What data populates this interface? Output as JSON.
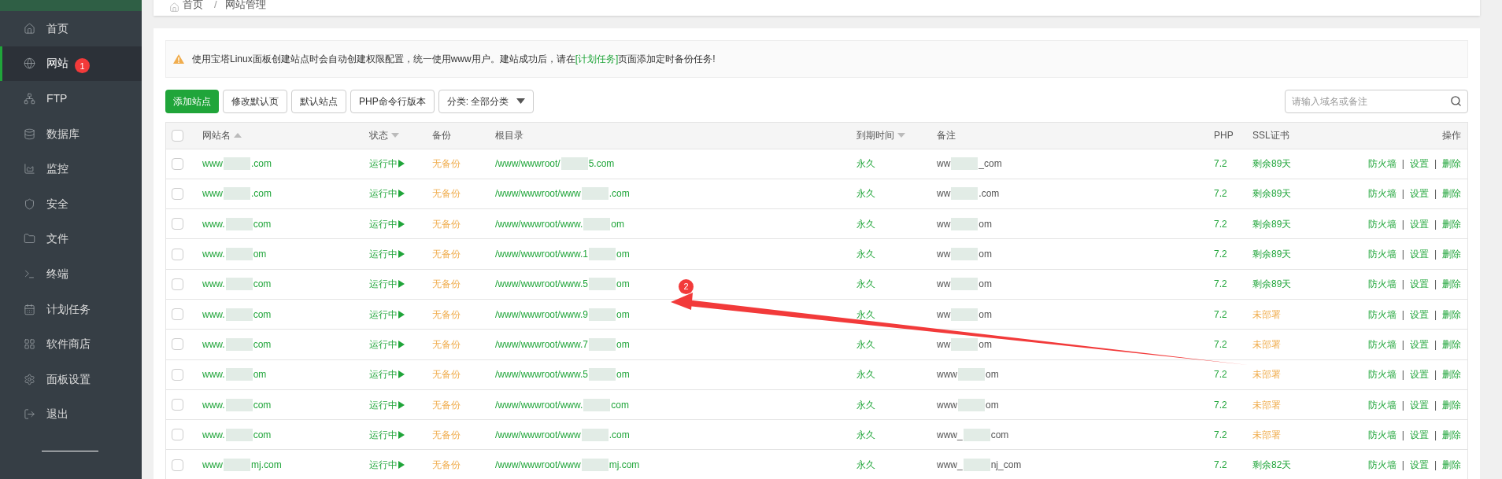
{
  "sidebar": {
    "items": [
      {
        "label": "首页",
        "selected": false
      },
      {
        "label": "网站",
        "selected": true,
        "badge": "1"
      },
      {
        "label": "FTP",
        "selected": false
      },
      {
        "label": "数据库",
        "selected": false
      },
      {
        "label": "监控",
        "selected": false
      },
      {
        "label": "安全",
        "selected": false
      },
      {
        "label": "文件",
        "selected": false
      },
      {
        "label": "终端",
        "selected": false
      },
      {
        "label": "计划任务",
        "selected": false
      },
      {
        "label": "软件商店",
        "selected": false
      },
      {
        "label": "面板设置",
        "selected": false
      },
      {
        "label": "退出",
        "selected": false
      }
    ]
  },
  "breadcrumb": {
    "items": [
      "首页",
      "网站管理"
    ],
    "separator": "/"
  },
  "alert": {
    "before": "使用宝塔Linux面板创建站点时会自动创建权限配置，统一使用www用户。建站成功后，请在",
    "link": "[计划任务]",
    "after": "页面添加定时备份任务!"
  },
  "toolbar": {
    "buttons": [
      {
        "label": "添加站点",
        "kind": "primary"
      },
      {
        "label": "修改默认页",
        "kind": "default"
      },
      {
        "label": "默认站点",
        "kind": "default"
      },
      {
        "label": "PHP命令行版本",
        "kind": "default"
      },
      {
        "label": "分类: 全部分类",
        "kind": "dropdown"
      }
    ],
    "search": {
      "placeholder": "请输入域名或备注"
    }
  },
  "table": {
    "header_checked": false,
    "action_separator": "|",
    "columns": [
      {
        "label": "网站名",
        "kind": "ascending"
      },
      {
        "label": "状态",
        "kind": "descending"
      },
      {
        "label": "备份",
        "kind": "plain"
      },
      {
        "label": "根目录",
        "kind": "plain"
      },
      {
        "label": "到期时间",
        "kind": "descending"
      },
      {
        "label": "备注",
        "kind": "plain"
      },
      {
        "label": "PHP",
        "kind": "plain"
      },
      {
        "label": "SSL证书",
        "kind": "plain"
      },
      {
        "label": "操作",
        "kind": "plain"
      }
    ],
    "rows": [
      {
        "checked": false,
        "name": [
          "www",
          ".com"
        ],
        "status": "运行中",
        "backup": "无备份",
        "root": [
          "/www/wwwroot/",
          "5.com"
        ],
        "expiry": "永久",
        "note": [
          "ww",
          "_com"
        ],
        "php": "7.2",
        "ssl": {
          "text": "剩余89天",
          "color": "#20a53a"
        },
        "actions": [
          "防火墙",
          "设置",
          "删除"
        ]
      },
      {
        "checked": false,
        "name": [
          "www",
          ".com"
        ],
        "status": "运行中",
        "backup": "无备份",
        "root": [
          "/www/wwwroot/www",
          ".com"
        ],
        "expiry": "永久",
        "note": [
          "ww",
          ".com"
        ],
        "php": "7.2",
        "ssl": {
          "text": "剩余89天",
          "color": "#20a53a"
        },
        "actions": [
          "防火墙",
          "设置",
          "删除"
        ]
      },
      {
        "checked": false,
        "name": [
          "www.",
          "com"
        ],
        "status": "运行中",
        "backup": "无备份",
        "root": [
          "/www/wwwroot/www.",
          "om"
        ],
        "expiry": "永久",
        "note": [
          "ww",
          "om"
        ],
        "php": "7.2",
        "ssl": {
          "text": "剩余89天",
          "color": "#20a53a"
        },
        "actions": [
          "防火墙",
          "设置",
          "删除"
        ]
      },
      {
        "checked": false,
        "name": [
          "www.",
          "om"
        ],
        "status": "运行中",
        "backup": "无备份",
        "root": [
          "/www/wwwroot/www.1",
          "om"
        ],
        "expiry": "永久",
        "note": [
          "ww",
          "om"
        ],
        "php": "7.2",
        "ssl": {
          "text": "剩余89天",
          "color": "#20a53a"
        },
        "actions": [
          "防火墙",
          "设置",
          "删除"
        ]
      },
      {
        "checked": false,
        "name": [
          "www.",
          "com"
        ],
        "status": "运行中",
        "backup": "无备份",
        "root": [
          "/www/wwwroot/www.5",
          "om"
        ],
        "expiry": "永久",
        "note": [
          "ww",
          "om"
        ],
        "php": "7.2",
        "ssl": {
          "text": "剩余89天",
          "color": "#20a53a"
        },
        "actions": [
          "防火墙",
          "设置",
          "删除"
        ]
      },
      {
        "checked": false,
        "name": [
          "www.",
          "com"
        ],
        "status": "运行中",
        "backup": "无备份",
        "root": [
          "/www/wwwroot/www.9",
          "om"
        ],
        "expiry": "永久",
        "note": [
          "ww",
          "om"
        ],
        "php": "7.2",
        "ssl": {
          "text": "未部署",
          "color": "#f0ad4e"
        },
        "actions": [
          "防火墙",
          "设置",
          "删除"
        ]
      },
      {
        "checked": false,
        "name": [
          "www.",
          "com"
        ],
        "status": "运行中",
        "backup": "无备份",
        "root": [
          "/www/wwwroot/www.7",
          "om"
        ],
        "expiry": "永久",
        "note": [
          "ww",
          "om"
        ],
        "php": "7.2",
        "ssl": {
          "text": "未部署",
          "color": "#f0ad4e"
        },
        "actions": [
          "防火墙",
          "设置",
          "删除"
        ]
      },
      {
        "checked": false,
        "name": [
          "www.",
          "om"
        ],
        "status": "运行中",
        "backup": "无备份",
        "root": [
          "/www/wwwroot/www.5",
          "om"
        ],
        "expiry": "永久",
        "note": [
          "www",
          "om"
        ],
        "php": "7.2",
        "ssl": {
          "text": "未部署",
          "color": "#f0ad4e"
        },
        "actions": [
          "防火墙",
          "设置",
          "删除"
        ]
      },
      {
        "checked": false,
        "name": [
          "www.",
          "com"
        ],
        "status": "运行中",
        "backup": "无备份",
        "root": [
          "/www/wwwroot/www.",
          "com"
        ],
        "expiry": "永久",
        "note": [
          "www",
          "om"
        ],
        "php": "7.2",
        "ssl": {
          "text": "未部署",
          "color": "#f0ad4e"
        },
        "actions": [
          "防火墙",
          "设置",
          "删除"
        ]
      },
      {
        "checked": false,
        "name": [
          "www.",
          "com"
        ],
        "status": "运行中",
        "backup": "无备份",
        "root": [
          "/www/wwwroot/www",
          ".com"
        ],
        "expiry": "永久",
        "note": [
          "www_",
          "com"
        ],
        "php": "7.2",
        "ssl": {
          "text": "未部署",
          "color": "#f0ad4e"
        },
        "actions": [
          "防火墙",
          "设置",
          "删除"
        ]
      },
      {
        "checked": false,
        "name": [
          "www",
          "mj.com"
        ],
        "status": "运行中",
        "backup": "无备份",
        "root": [
          "/www/wwwroot/www",
          "mj.com"
        ],
        "expiry": "永久",
        "note": [
          "www_",
          "nj_com"
        ],
        "php": "7.2",
        "ssl": {
          "text": "剩余82天",
          "color": "#20a53a"
        },
        "actions": [
          "防火墙",
          "设置",
          "删除"
        ]
      }
    ]
  },
  "annotation": {
    "badge": "2"
  }
}
